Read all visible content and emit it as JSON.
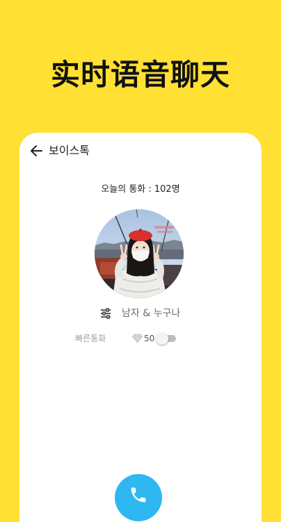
{
  "promo": {
    "title": "实时语音聊天"
  },
  "header": {
    "title": "보이스톡",
    "back_icon": "arrow-left-icon"
  },
  "main": {
    "call_count_text": "오늘의 통화 : 102명",
    "filter": {
      "icon": "sliders-icon",
      "label": "남자 & 누구나"
    },
    "quick_call": {
      "label": "빠른통화",
      "cost_icon": "diamond-icon",
      "cost": "50",
      "enabled": false
    },
    "call_button_icon": "phone-icon"
  },
  "colors": {
    "background": "#FFE033",
    "card": "#FFFFFF",
    "accent": "#2EB7F0",
    "text_primary": "#1F1F1F",
    "text_secondary": "#9E9E9E"
  }
}
